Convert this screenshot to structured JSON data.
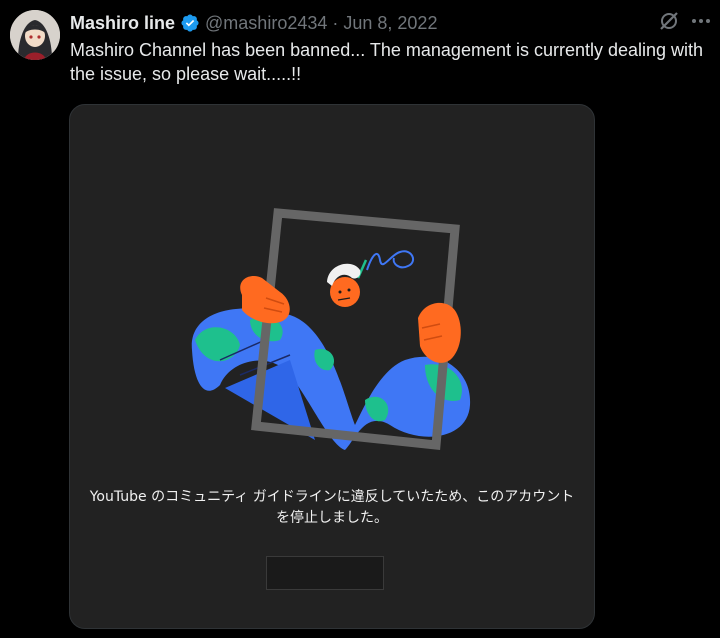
{
  "author": {
    "display_name": "Mashiro line",
    "handle": "@mashiro2434",
    "separator": "·",
    "date": "Jun 8, 2022"
  },
  "icons": {
    "avatar": "avatar-image",
    "verified": "verified-badge-icon",
    "grok": "grok-icon",
    "more": "more-icon"
  },
  "tweet": {
    "text": "Mashiro Channel has been banned... The management is currently dealing with the issue, so please wait.....!!"
  },
  "card": {
    "message": "YouTube のコミュニティ ガイドラインに違反していたため、このアカウントを停止しました。",
    "button_label": ""
  },
  "colors": {
    "background": "#000000",
    "card_background": "#222222",
    "verified_blue": "#1d9bf0",
    "muted_text": "#71767b",
    "primary_text": "#e7e9ea"
  }
}
